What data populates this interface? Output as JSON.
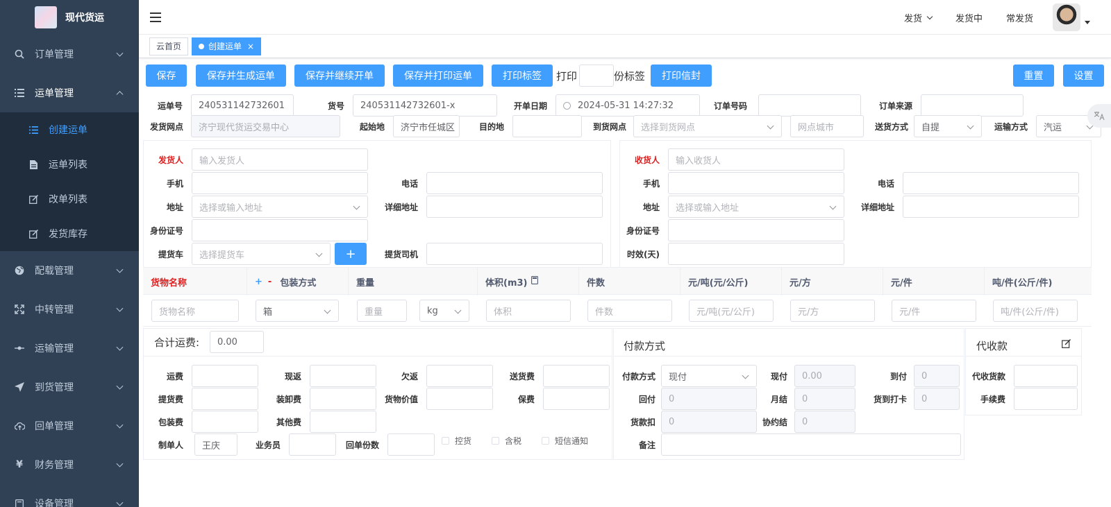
{
  "sidebar": {
    "logo_text": "现代货运",
    "menu": {
      "orders": "订单管理",
      "waybill": "运单管理",
      "waybill_sub": [
        "创建运单",
        "运单列表",
        "改单列表",
        "发货库存"
      ],
      "loading": "配载管理",
      "transfer": "中转管理",
      "transport": "运输管理",
      "arrival": "到货管理",
      "receipt": "回单管理",
      "finance": "财务管理",
      "device": "设备管理"
    }
  },
  "navbar": {
    "ship": "发货",
    "shipping": "发货中",
    "frequent": "常发货"
  },
  "tags": {
    "home": "云首页",
    "current": "创建运单",
    "close": "×"
  },
  "toolbar": {
    "save": "保存",
    "save_generate": "保存并生成运单",
    "save_continue": "保存并继续开单",
    "save_print": "保存并打印运单",
    "print_label": "打印标签",
    "print_prefix": "打印",
    "print_suffix": "份标签",
    "print_envelope": "打印信封",
    "reset": "重置",
    "settings": "设置"
  },
  "header_fields": {
    "waybill_no_label": "运单号",
    "waybill_no": "240531142732601",
    "cargo_no_label": "货号",
    "cargo_no": "240531142732601-x",
    "open_date_label": "开单日期",
    "open_date": "2024-05-31 14:27:32",
    "order_no_label": "订单号码",
    "order_source_label": "订单来源",
    "ship_station_label": "发货网点",
    "ship_station": "济宁现代货运交易中心",
    "origin_label": "起始地",
    "origin": "济宁市任城区",
    "destination_label": "目的地",
    "arrival_station_label": "到货网点",
    "arrival_station_ph": "选择到货网点",
    "station_city_ph": "网点城市",
    "delivery_mode_label": "送货方式",
    "delivery_mode": "自提",
    "transport_mode_label": "运输方式",
    "transport_mode": "汽运"
  },
  "sender": {
    "name_label": "发货人",
    "name_ph": "输入发货人",
    "mobile_label": "手机",
    "phone_label": "电话",
    "address_label": "地址",
    "address_ph": "选择或输入地址",
    "detail_address_label": "详细地址",
    "id_label": "身份证号",
    "pickup_car_label": "提货车",
    "pickup_car_ph": "选择提货车",
    "add": "+",
    "pickup_driver_label": "提货司机"
  },
  "receiver": {
    "name_label": "收货人",
    "name_ph": "输入收货人",
    "mobile_label": "手机",
    "phone_label": "电话",
    "address_label": "地址",
    "address_ph": "选择或输入地址",
    "detail_address_label": "详细地址",
    "id_label": "身份证号",
    "aging_label": "时效(天)"
  },
  "goods": {
    "headers": {
      "name": "货物名称",
      "plus": "+",
      "minus": "-",
      "package": "包装方式",
      "weight": "重量",
      "volume": "体积(m3)",
      "count": "件数",
      "per_ton": "元/吨(元/公斤)",
      "per_cube": "元/方",
      "per_piece": "元/件",
      "ton_piece": "吨/件(公斤/件)"
    },
    "row": {
      "name_ph": "货物名称",
      "package": "箱",
      "weight_ph": "重量",
      "unit": "kg",
      "volume_ph": "体积",
      "count_ph": "件数",
      "per_ton_ph": "元/吨(元/公斤)",
      "per_cube_ph": "元/方",
      "per_piece_ph": "元/件",
      "ton_piece_ph": "吨/件(公斤/件)"
    }
  },
  "fees": {
    "total_label": "合计运费:",
    "total": "0.00",
    "freight": "运费",
    "cash_return": "现返",
    "owe_return": "欠返",
    "delivery_fee": "送货费",
    "pickup_fee": "提货费",
    "handling_fee": "装卸费",
    "cargo_value": "货物价值",
    "insurance": "保费",
    "packing_fee": "包装费",
    "other_fee": "其他费",
    "creator_label": "制单人",
    "creator": "王庆",
    "salesman_label": "业务员",
    "receipt_count_label": "回单份数",
    "hold": "控货",
    "tax": "含税",
    "sms": "短信通知"
  },
  "payment": {
    "title": "付款方式",
    "method_label": "付款方式",
    "method": "现付",
    "cash_label": "现付",
    "cash": "0.00",
    "arrive_label": "到付",
    "arrive": "0",
    "back_label": "回付",
    "back": "0",
    "monthly_label": "月结",
    "monthly": "0",
    "arrive_card_label": "货到打卡",
    "arrive_card": "0",
    "deduct_label": "货款扣",
    "deduct": "0",
    "agreement_label": "协约结",
    "agreement": "0",
    "remark_label": "备注"
  },
  "cod": {
    "title": "代收款",
    "amount_label": "代收货款",
    "fee_label": "手续费"
  }
}
